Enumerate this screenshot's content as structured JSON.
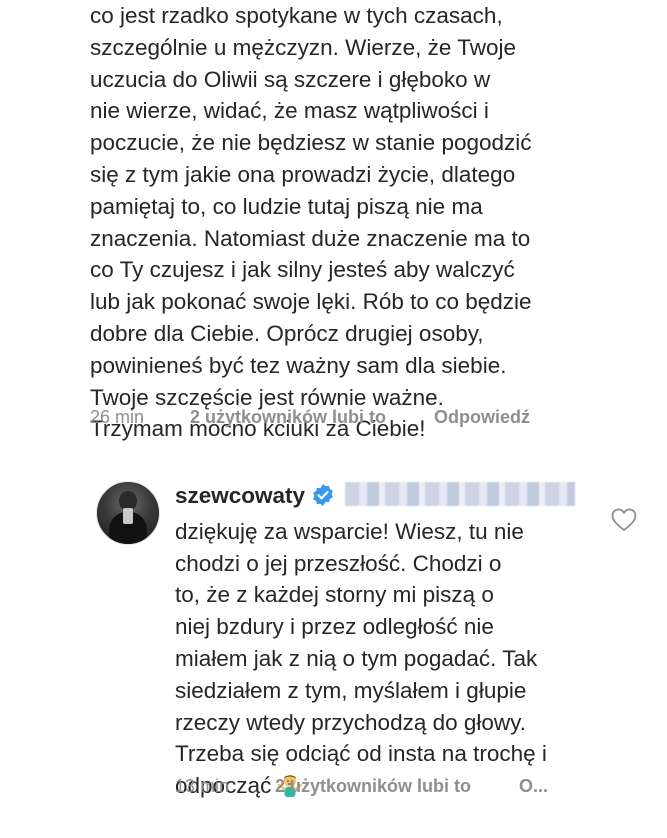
{
  "comment1": {
    "lines": [
      "co jest rzadko spotykane w tych czasach,",
      "szczególnie u mężczyzn. Wierze, że Twoje",
      "uczucia do Oliwii są szczere i głęboko w",
      "nie wierze, widać, że masz wątpliwości i",
      "poczucie, że nie będziesz w stanie pogodzić",
      "się z tym jakie ona prowadzi życie, dlatego",
      "pamiętaj to, co ludzie tutaj piszą nie ma",
      "znaczenia. Natomiast duże znaczenie ma to",
      "co Ty czujesz i jak silny jesteś aby walczyć",
      "lub jak pokonać swoje lęki.  Rób to co będzie",
      "dobre dla Ciebie. Oprócz drugiej osoby,",
      "powinieneś być tez ważny sam dla siebie.",
      "Twoje szczęście jest równie ważne.",
      "Trzymam mocno kciuki za Ciebie!"
    ],
    "time": "26 min",
    "likes": "2 użytkowników lubi to",
    "reply_label": "Odpowiedź"
  },
  "reply": {
    "username": "szewcowaty",
    "lines": [
      "dziękuję za wsparcie! Wiesz, tu nie",
      "chodzi o jej przeszłość. Chodzi  o",
      "to, że z każdej storny mi piszą o",
      "niej bzdury i przez odległość nie",
      "miałem jak z nią o tym pogadać. Tak",
      "siedziałem z tym, myślałem i głupie",
      "rzeczy wtedy przychodzą do głowy.",
      "Trzeba się odciąć od insta na trochę i",
      "odpocząć"
    ],
    "time": "13 min",
    "likes": "2 użytkowników lubi to",
    "reply_label": "O..."
  },
  "icons": {
    "verified": "verified-badge-icon",
    "like": "heart-icon",
    "emoji": "person-shrugging-emoji"
  },
  "colors": {
    "text": "#262626",
    "meta": "#8e8e8e",
    "verified": "#3897f0"
  }
}
